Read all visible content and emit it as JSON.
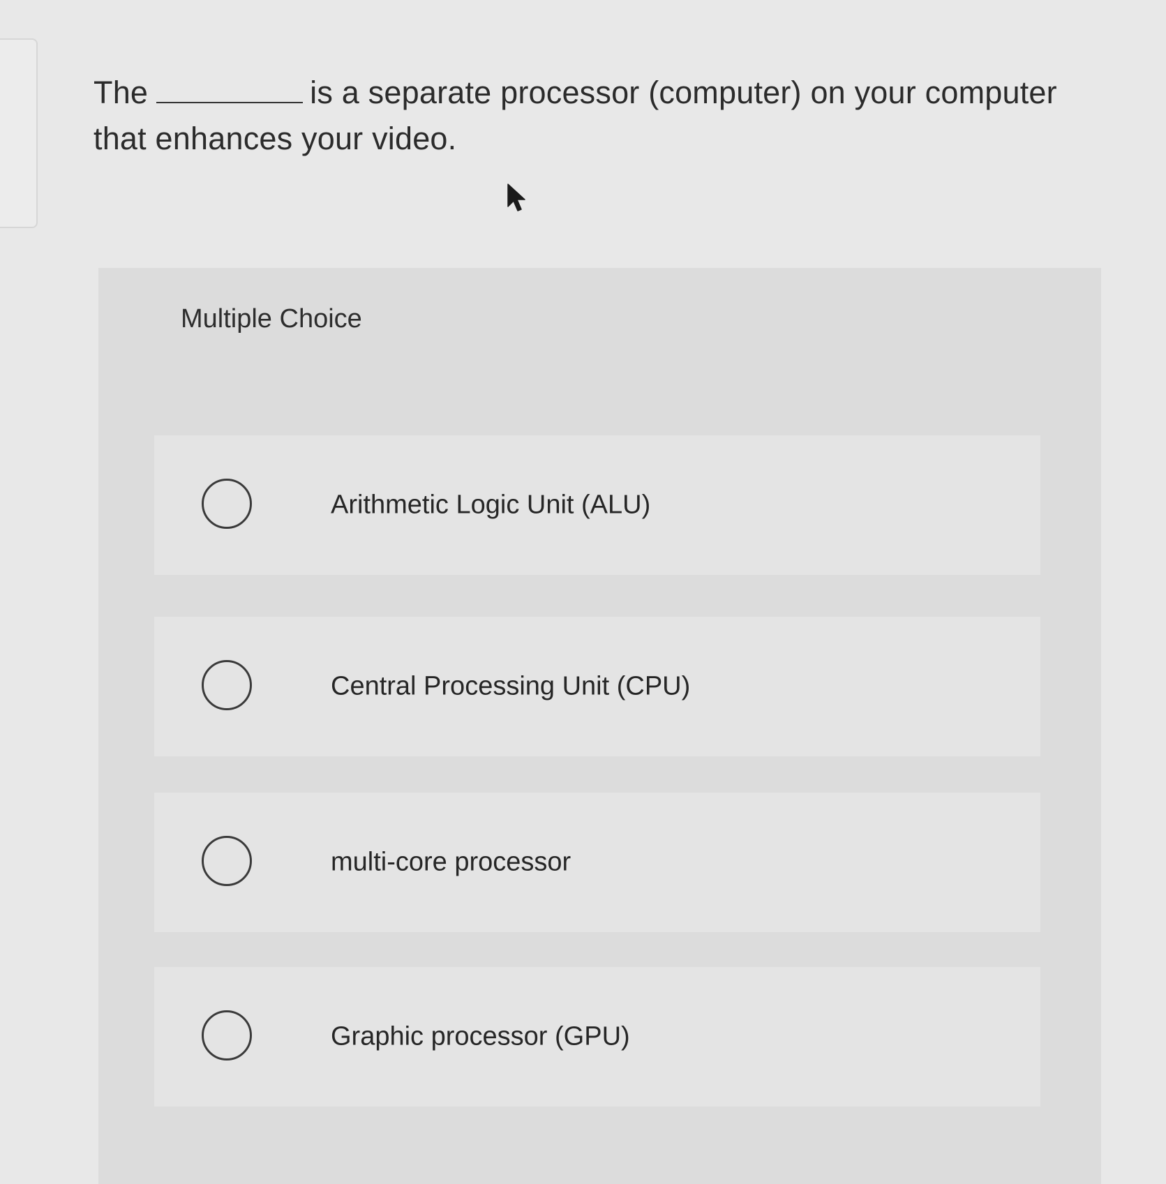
{
  "question": {
    "prefix": "The",
    "suffix": "is a separate processor (computer) on your computer that enhances your video."
  },
  "panel": {
    "label": "Multiple Choice",
    "options": [
      {
        "label": "Arithmetic Logic Unit (ALU)"
      },
      {
        "label": "Central Processing Unit (CPU)"
      },
      {
        "label": "multi-core processor"
      },
      {
        "label": "Graphic processor (GPU)"
      }
    ]
  }
}
